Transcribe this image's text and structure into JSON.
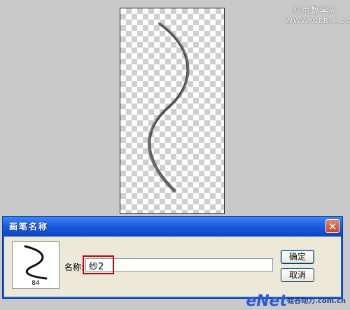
{
  "watermark_top": {
    "line1": "网页教学网",
    "line2": "WWW.WEBJX.COM"
  },
  "dialog": {
    "title": "画笔名称",
    "close_label": "✕",
    "name_label": "名称:",
    "name_value": "纱2",
    "brush_size": "84",
    "ok_label": "确定",
    "cancel_label": "取消"
  },
  "watermark_bottom": {
    "brand": "eNet",
    "sub": "硅谷动力.com.cn"
  }
}
